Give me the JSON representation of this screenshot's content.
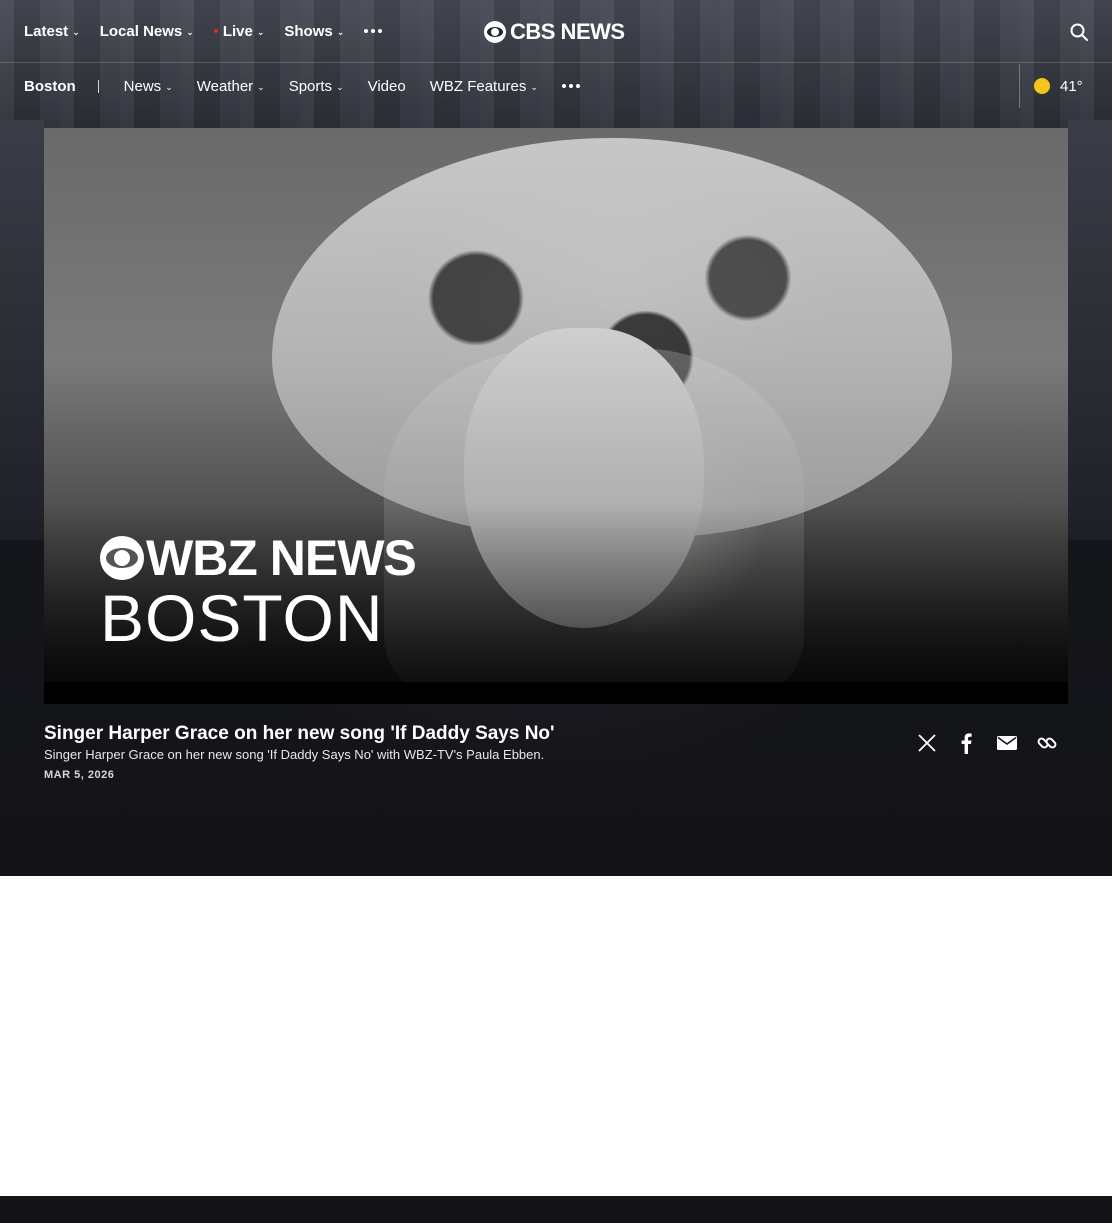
{
  "topnav": {
    "items": [
      {
        "label": "Latest"
      },
      {
        "label": "Local News"
      },
      {
        "label": "Live"
      },
      {
        "label": "Shows"
      }
    ],
    "more_icon": "more-dots-icon",
    "logo_text": "CBS NEWS",
    "search_icon": "search-icon"
  },
  "subnav": {
    "city": "Boston",
    "items": [
      {
        "label": "News",
        "dropdown": true
      },
      {
        "label": "Weather",
        "dropdown": true
      },
      {
        "label": "Sports",
        "dropdown": true
      },
      {
        "label": "Video",
        "dropdown": false
      },
      {
        "label": "WBZ Features",
        "dropdown": true
      }
    ],
    "weather": {
      "temp": "41°",
      "icon": "sun-icon",
      "color": "#f5c518"
    }
  },
  "video": {
    "overlay_logo": "WBZ NEWS",
    "overlay_city": "BOSTON"
  },
  "caption": {
    "title": "Singer Harper Grace on her new song 'If Daddy Says No'",
    "description": "Singer Harper Grace on her new song 'If Daddy Says No' with WBZ-TV's Paula Ebben.",
    "date": "MAR 5, 2026"
  },
  "share": [
    "x-icon",
    "facebook-icon",
    "email-icon",
    "link-icon"
  ],
  "colors": {
    "live_dot": "#e0252b",
    "background_dark": "#15161b"
  }
}
